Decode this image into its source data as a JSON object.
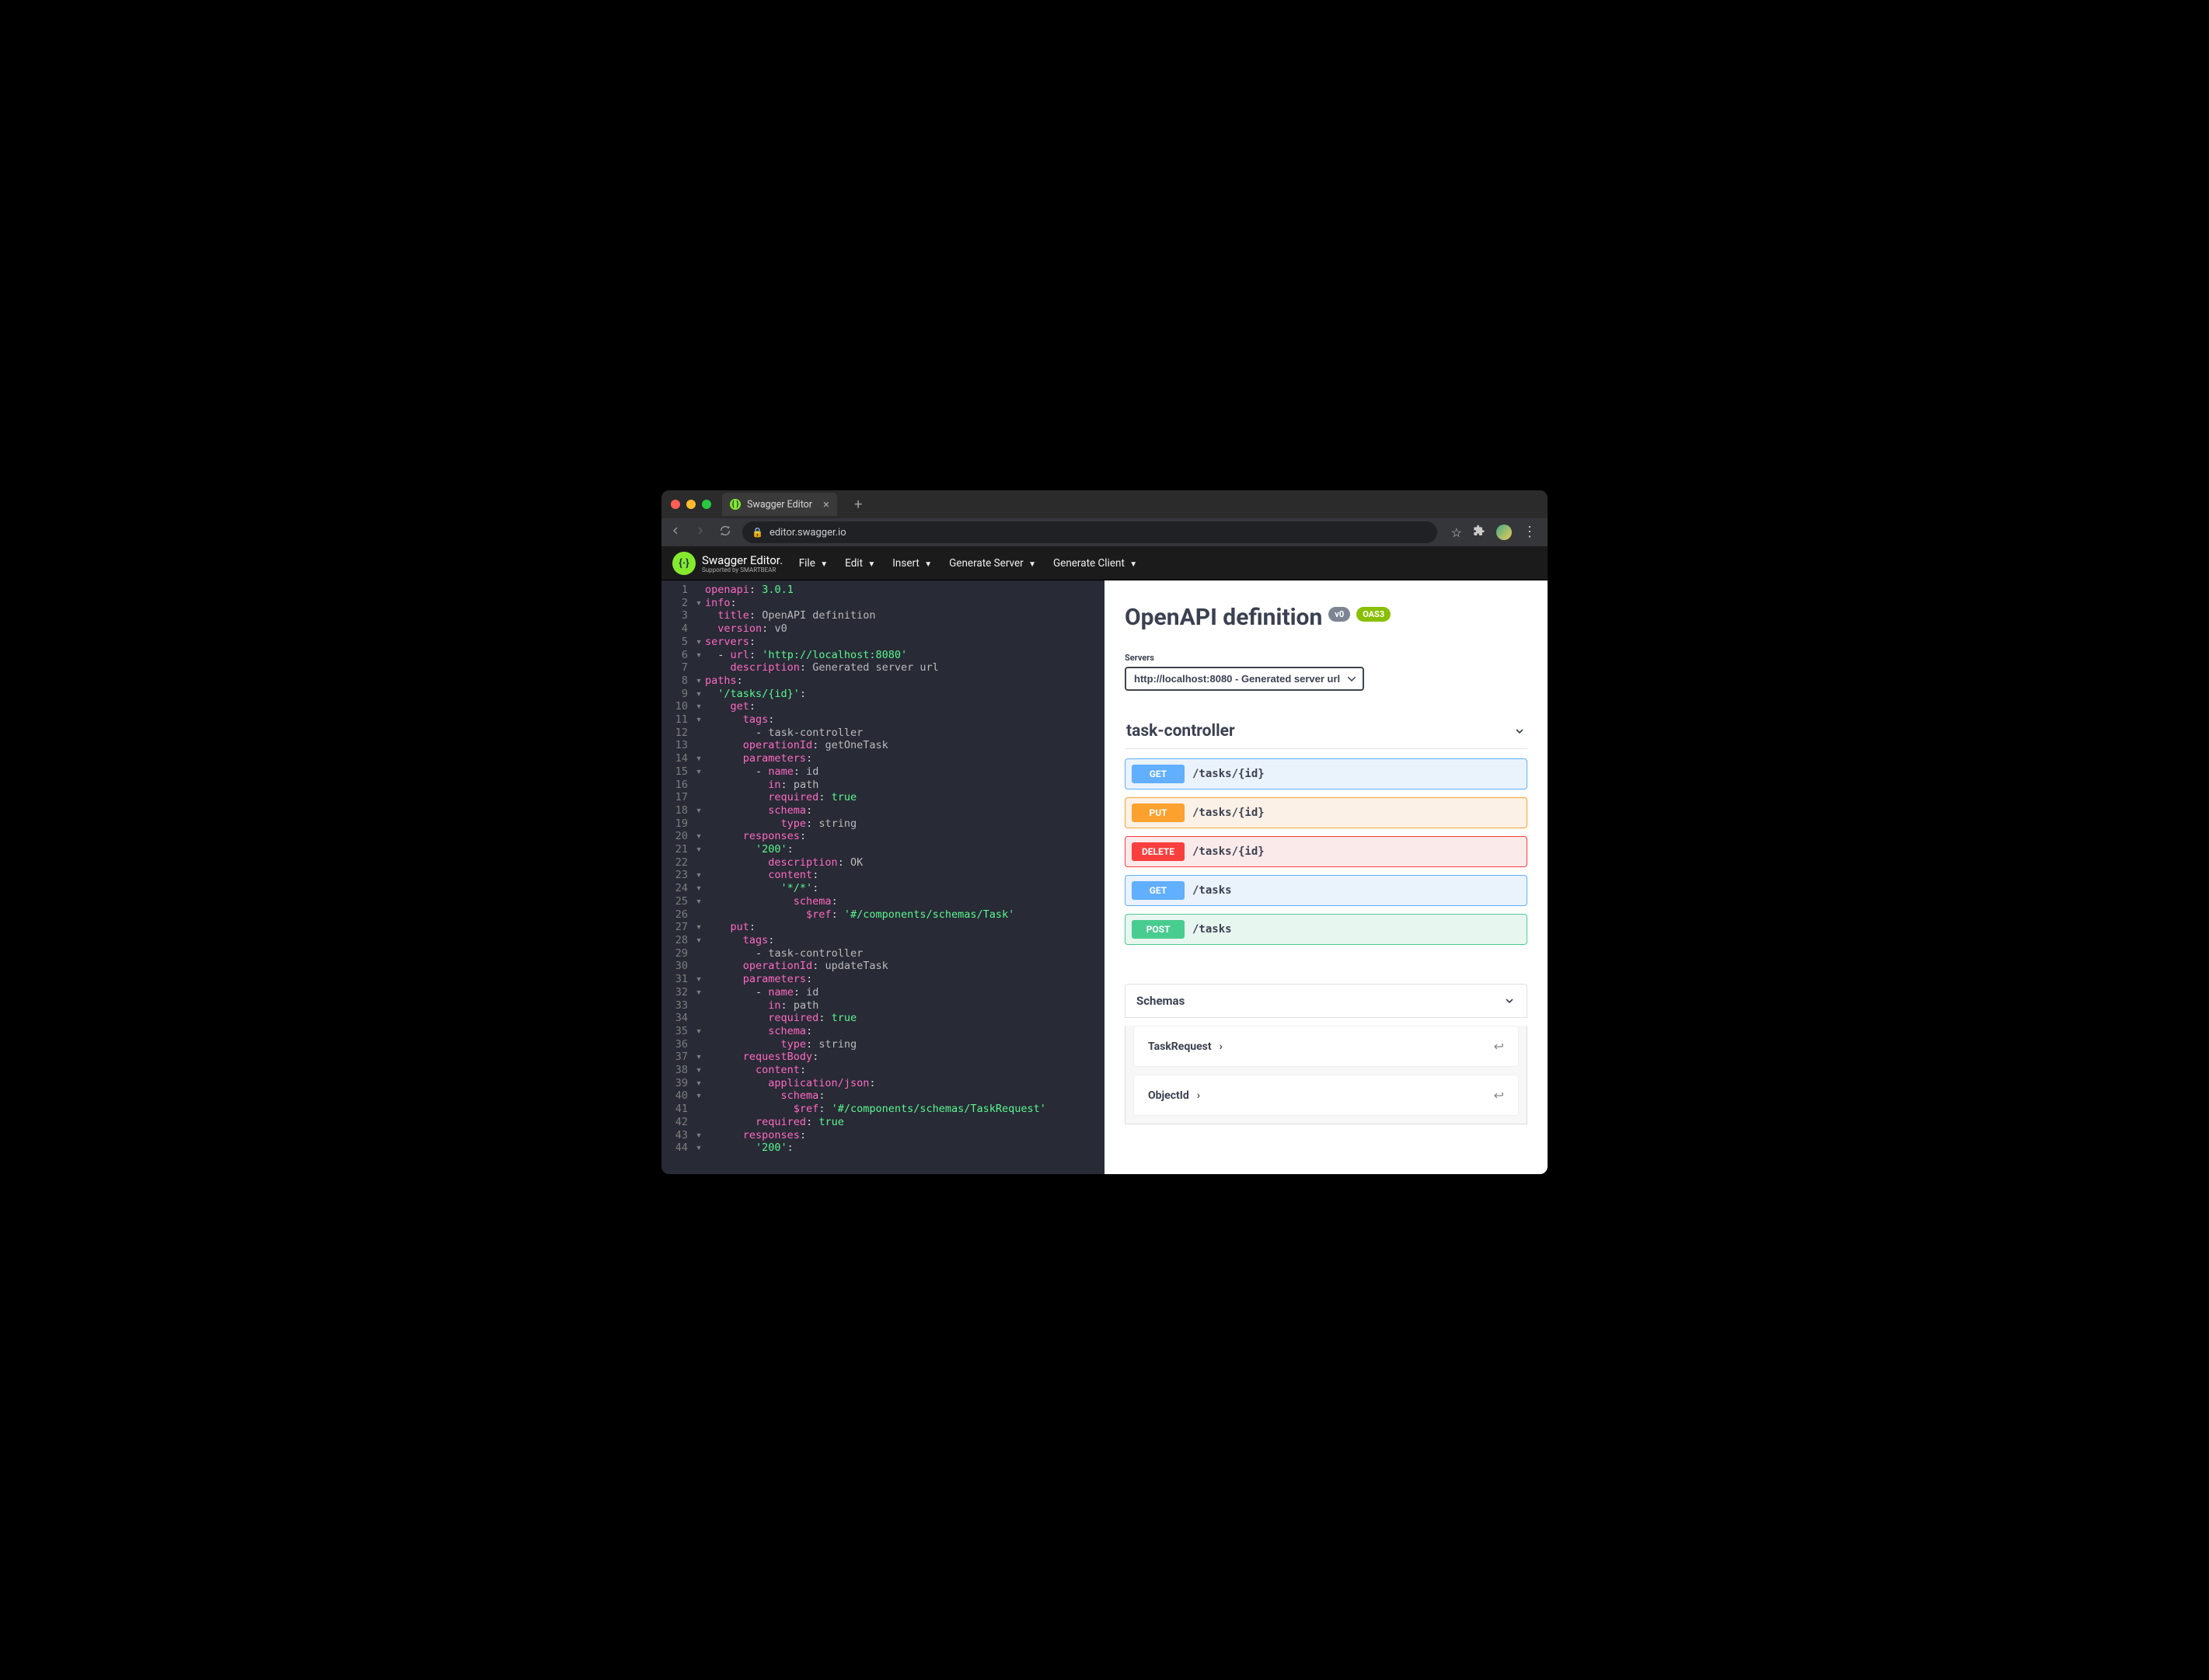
{
  "browser": {
    "tab_title": "Swagger Editor",
    "url": "editor.swagger.io"
  },
  "app": {
    "logo_text": "Swagger Editor",
    "logo_sub": "Supported by SMARTBEAR",
    "menu": [
      "File",
      "Edit",
      "Insert",
      "Generate Server",
      "Generate Client"
    ]
  },
  "code": {
    "lines": [
      {
        "n": 1,
        "fold": "",
        "html": "<span class='key'>openapi</span><span class='punc'>:</span> <span class='str'>3.0.1</span>"
      },
      {
        "n": 2,
        "fold": "▾",
        "html": "<span class='key'>info</span><span class='punc'>:</span>"
      },
      {
        "n": 3,
        "fold": "",
        "html": "  <span class='key'>title</span><span class='punc'>:</span> <span class='mut'>OpenAPI definition</span>"
      },
      {
        "n": 4,
        "fold": "",
        "html": "  <span class='key'>version</span><span class='punc'>:</span> <span class='mut'>v0</span>"
      },
      {
        "n": 5,
        "fold": "▾",
        "html": "<span class='key'>servers</span><span class='punc'>:</span>"
      },
      {
        "n": 6,
        "fold": "▾",
        "html": "  <span class='punc'>-</span> <span class='key'>url</span><span class='punc'>:</span> <span class='str'>'http://localhost:8080'</span>"
      },
      {
        "n": 7,
        "fold": "",
        "html": "    <span class='key'>description</span><span class='punc'>:</span> <span class='mut'>Generated server url</span>"
      },
      {
        "n": 8,
        "fold": "▾",
        "html": "<span class='key'>paths</span><span class='punc'>:</span>"
      },
      {
        "n": 9,
        "fold": "▾",
        "html": "  <span class='str'>'/tasks/{id}'</span><span class='punc'>:</span>"
      },
      {
        "n": 10,
        "fold": "▾",
        "html": "    <span class='key'>get</span><span class='punc'>:</span>"
      },
      {
        "n": 11,
        "fold": "▾",
        "html": "      <span class='key'>tags</span><span class='punc'>:</span>"
      },
      {
        "n": 12,
        "fold": "",
        "html": "        <span class='punc'>-</span> <span class='mut'>task-controller</span>"
      },
      {
        "n": 13,
        "fold": "",
        "html": "      <span class='key'>operationId</span><span class='punc'>:</span> <span class='mut'>getOneTask</span>"
      },
      {
        "n": 14,
        "fold": "▾",
        "html": "      <span class='key'>parameters</span><span class='punc'>:</span>"
      },
      {
        "n": 15,
        "fold": "▾",
        "html": "        <span class='punc'>-</span> <span class='key'>name</span><span class='punc'>:</span> <span class='mut'>id</span>"
      },
      {
        "n": 16,
        "fold": "",
        "html": "          <span class='key'>in</span><span class='punc'>:</span> <span class='mut'>path</span>"
      },
      {
        "n": 17,
        "fold": "",
        "html": "          <span class='key'>required</span><span class='punc'>:</span> <span class='str'>true</span>"
      },
      {
        "n": 18,
        "fold": "▾",
        "html": "          <span class='key'>schema</span><span class='punc'>:</span>"
      },
      {
        "n": 19,
        "fold": "",
        "html": "            <span class='key'>type</span><span class='punc'>:</span> <span class='mut'>string</span>"
      },
      {
        "n": 20,
        "fold": "▾",
        "html": "      <span class='key'>responses</span><span class='punc'>:</span>"
      },
      {
        "n": 21,
        "fold": "▾",
        "html": "        <span class='str'>'200'</span><span class='punc'>:</span>"
      },
      {
        "n": 22,
        "fold": "",
        "html": "          <span class='key'>description</span><span class='punc'>:</span> <span class='mut'>OK</span>"
      },
      {
        "n": 23,
        "fold": "▾",
        "html": "          <span class='key'>content</span><span class='punc'>:</span>"
      },
      {
        "n": 24,
        "fold": "▾",
        "html": "            <span class='str'>'*/*'</span><span class='punc'>:</span>"
      },
      {
        "n": 25,
        "fold": "▾",
        "html": "              <span class='key'>schema</span><span class='punc'>:</span>"
      },
      {
        "n": 26,
        "fold": "",
        "html": "                <span class='key'>$ref</span><span class='punc'>:</span> <span class='str'>'#/components/schemas/Task'</span>"
      },
      {
        "n": 27,
        "fold": "▾",
        "html": "    <span class='key'>put</span><span class='punc'>:</span>"
      },
      {
        "n": 28,
        "fold": "▾",
        "html": "      <span class='key'>tags</span><span class='punc'>:</span>"
      },
      {
        "n": 29,
        "fold": "",
        "html": "        <span class='punc'>-</span> <span class='mut'>task-controller</span>"
      },
      {
        "n": 30,
        "fold": "",
        "html": "      <span class='key'>operationId</span><span class='punc'>:</span> <span class='mut'>updateTask</span>"
      },
      {
        "n": 31,
        "fold": "▾",
        "html": "      <span class='key'>parameters</span><span class='punc'>:</span>"
      },
      {
        "n": 32,
        "fold": "▾",
        "html": "        <span class='punc'>-</span> <span class='key'>name</span><span class='punc'>:</span> <span class='mut'>id</span>"
      },
      {
        "n": 33,
        "fold": "",
        "html": "          <span class='key'>in</span><span class='punc'>:</span> <span class='mut'>path</span>"
      },
      {
        "n": 34,
        "fold": "",
        "html": "          <span class='key'>required</span><span class='punc'>:</span> <span class='str'>true</span>"
      },
      {
        "n": 35,
        "fold": "▾",
        "html": "          <span class='key'>schema</span><span class='punc'>:</span>"
      },
      {
        "n": 36,
        "fold": "",
        "html": "            <span class='key'>type</span><span class='punc'>:</span> <span class='mut'>string</span>"
      },
      {
        "n": 37,
        "fold": "▾",
        "html": "      <span class='key'>requestBody</span><span class='punc'>:</span>"
      },
      {
        "n": 38,
        "fold": "▾",
        "html": "        <span class='key'>content</span><span class='punc'>:</span>"
      },
      {
        "n": 39,
        "fold": "▾",
        "html": "          <span class='key'>application/json</span><span class='punc'>:</span>"
      },
      {
        "n": 40,
        "fold": "▾",
        "html": "            <span class='key'>schema</span><span class='punc'>:</span>"
      },
      {
        "n": 41,
        "fold": "",
        "html": "              <span class='key'>$ref</span><span class='punc'>:</span> <span class='str'>'#/components/schemas/TaskRequest'</span>"
      },
      {
        "n": 42,
        "fold": "",
        "html": "        <span class='key'>required</span><span class='punc'>:</span> <span class='str'>true</span>"
      },
      {
        "n": 43,
        "fold": "▾",
        "html": "      <span class='key'>responses</span><span class='punc'>:</span>"
      },
      {
        "n": 44,
        "fold": "▾",
        "html": "        <span class='str'>'200'</span><span class='punc'>:</span>"
      }
    ]
  },
  "preview": {
    "title": "OpenAPI definition",
    "version": "v0",
    "oas": "OAS3",
    "servers_label": "Servers",
    "server_selected": "http://localhost:8080 - Generated server url",
    "tag": "task-controller",
    "ops": [
      {
        "method": "GET",
        "cls": "get",
        "path": "/tasks/{id}"
      },
      {
        "method": "PUT",
        "cls": "put",
        "path": "/tasks/{id}"
      },
      {
        "method": "DELETE",
        "cls": "del",
        "path": "/tasks/{id}"
      },
      {
        "method": "GET",
        "cls": "get",
        "path": "/tasks"
      },
      {
        "method": "POST",
        "cls": "post",
        "path": "/tasks"
      }
    ],
    "schemas_title": "Schemas",
    "schemas": [
      "TaskRequest",
      "ObjectId"
    ]
  }
}
